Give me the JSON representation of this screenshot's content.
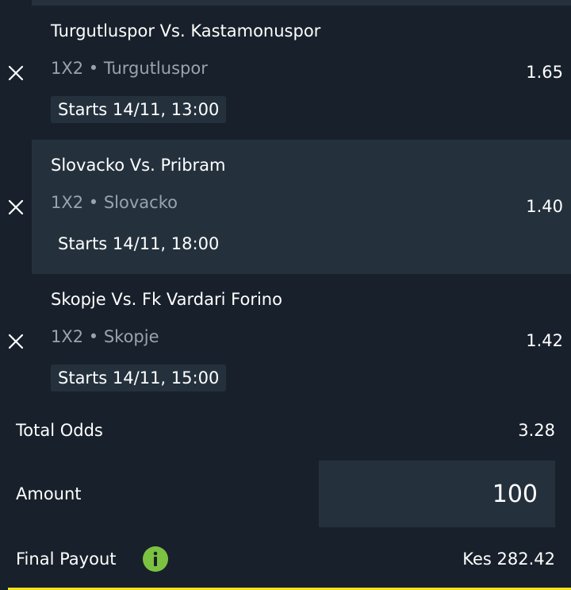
{
  "bets": [
    {
      "match": "Turgutluspor Vs. Kastamonuspor",
      "market": "1X2 • Turgutluspor",
      "start": "Starts 14/11, 13:00",
      "odds": "1.65",
      "highlighted": false
    },
    {
      "match": "Slovacko Vs. Pribram",
      "market": "1X2 • Slovacko",
      "start": "Starts 14/11, 18:00",
      "odds": "1.40",
      "highlighted": true
    },
    {
      "match": "Skopje Vs. Fk Vardari Forino",
      "market": "1X2 • Skopje",
      "start": "Starts 14/11, 15:00",
      "odds": "1.42",
      "highlighted": false
    }
  ],
  "summary": {
    "total_odds_label": "Total Odds",
    "total_odds_value": "3.28",
    "amount_label": "Amount",
    "amount_value": "100",
    "payout_label": "Final Payout",
    "payout_value": "Kes 282.42"
  },
  "icons": {
    "remove": "close-icon",
    "info": "info-icon"
  },
  "colors": {
    "background": "#18202b",
    "panel": "#24313d",
    "muted_text": "#9aa3ad",
    "info_green": "#7cc142",
    "accent_yellow": "#f2e61a"
  }
}
